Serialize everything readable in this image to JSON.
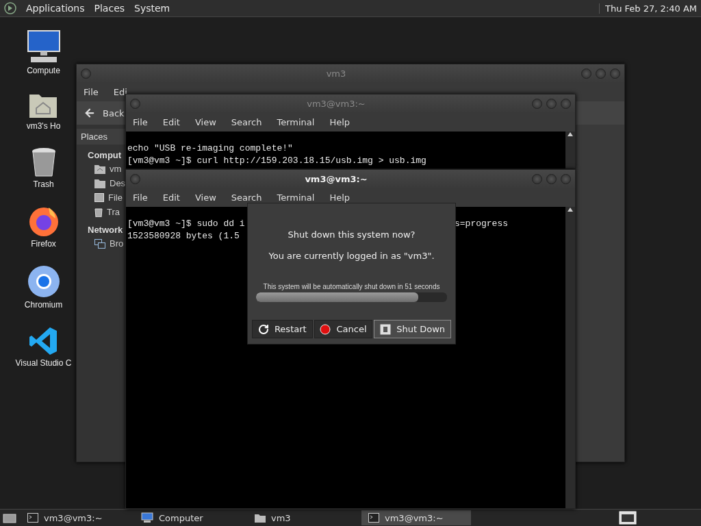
{
  "top_panel": {
    "menus": [
      "Applications",
      "Places",
      "System"
    ],
    "clock": "Thu Feb 27, 2:40 AM"
  },
  "desktop_icons": [
    {
      "kind": "computer",
      "label": "Compute"
    },
    {
      "kind": "home",
      "label": "vm3's Ho"
    },
    {
      "kind": "trash",
      "label": "Trash"
    },
    {
      "kind": "firefox",
      "label": "Firefox"
    },
    {
      "kind": "chromium",
      "label": "Chromium"
    },
    {
      "kind": "vscode",
      "label": "Visual Studio C"
    }
  ],
  "file_manager": {
    "title": "vm3",
    "active": false,
    "menu": [
      "File",
      "Edi"
    ],
    "back": "Back",
    "sidebar": {
      "header": "Places",
      "sections": [
        {
          "heading": "Comput",
          "items": [
            {
              "kind": "home",
              "label": "vm"
            },
            {
              "kind": "desktop",
              "label": "Des"
            },
            {
              "kind": "drive",
              "label": "File"
            },
            {
              "kind": "trash",
              "label": "Tra"
            }
          ]
        },
        {
          "heading": "Network",
          "items": [
            {
              "kind": "network",
              "label": "Bro"
            }
          ]
        }
      ]
    }
  },
  "terminals": [
    {
      "title": "vm3@vm3:~",
      "active": false,
      "menu": [
        "File",
        "Edit",
        "View",
        "Search",
        "Terminal",
        "Help"
      ],
      "lines": [
        {
          "left": "echo \"USB re-imaging complete!\""
        },
        {
          "left": "[vm3@vm3 ~]$ curl http://159.203.18.15/usb.img > usb.img"
        }
      ]
    },
    {
      "title": "vm3@vm3:~",
      "active": true,
      "menu": [
        "File",
        "Edit",
        "View",
        "Search",
        "Terminal",
        "Help"
      ],
      "lines": [
        {
          "left": "[vm3@vm3 ~]$ sudo dd i",
          "right": "s=progress"
        },
        {
          "left": "1523580928 bytes (1.5"
        }
      ]
    }
  ],
  "dialog": {
    "question": "Shut down this system now?",
    "message": "You are currently logged in as \"vm3\".",
    "countdown": "This system will be automatically shut down in 51 seconds",
    "level": 0.85,
    "buttons": [
      {
        "kind": "restart",
        "label": "Restart",
        "selected": false
      },
      {
        "kind": "cancel",
        "label": "Cancel",
        "selected": false
      },
      {
        "kind": "shutdown",
        "label": "Shut Down",
        "selected": true
      }
    ]
  },
  "taskbar": {
    "tasks": [
      {
        "kind": "terminal",
        "label": "vm3@vm3:~",
        "selected": false
      },
      {
        "kind": "computer",
        "label": "Computer",
        "selected": false
      },
      {
        "kind": "folder",
        "label": "vm3",
        "selected": false
      },
      {
        "kind": "terminal",
        "label": "vm3@vm3:~",
        "selected": true
      }
    ]
  }
}
